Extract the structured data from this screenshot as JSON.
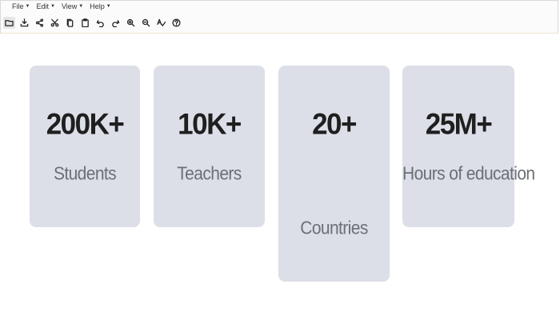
{
  "menu": {
    "items": [
      {
        "label": "File"
      },
      {
        "label": "Edit"
      },
      {
        "label": "View"
      },
      {
        "label": "Help"
      }
    ]
  },
  "toolbar": {
    "icons": [
      "folder-icon",
      "download-icon",
      "share-icon",
      "cut-icon",
      "copy-icon",
      "paste-icon",
      "undo-icon",
      "redo-icon",
      "zoom-in-icon",
      "zoom-out-icon",
      "spellcheck-icon",
      "help-icon"
    ]
  },
  "stats": [
    {
      "value": "200K+",
      "label": "Students"
    },
    {
      "value": "10K+",
      "label": "Teachers"
    },
    {
      "value": "20+",
      "label": "Countries"
    },
    {
      "value": "25M+",
      "label": "Hours of education"
    }
  ],
  "colors": {
    "card_bg": "#dcdfe7",
    "stat_text": "#1f1f1f",
    "label_text": "#6b6f76"
  }
}
